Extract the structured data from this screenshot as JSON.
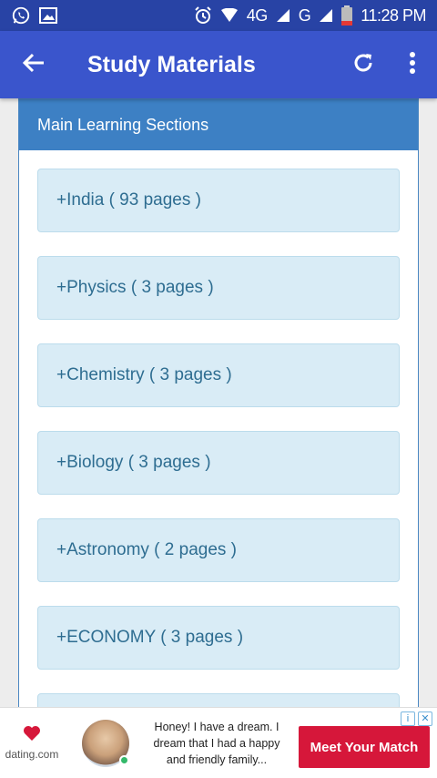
{
  "status_bar": {
    "network_4g": "4G",
    "network_g": "G",
    "time": "11:28 PM",
    "icons": [
      "whatsapp-icon",
      "image-icon",
      "alarm-icon",
      "wifi-icon",
      "signal-icon",
      "battery-icon"
    ]
  },
  "app_bar": {
    "title": "Study Materials",
    "icons": [
      "back-arrow-icon",
      "refresh-icon",
      "more-vert-icon"
    ]
  },
  "panel": {
    "header": "Main Learning Sections",
    "sections": [
      {
        "label": "+India ( 93 pages )"
      },
      {
        "label": "+Physics ( 3 pages )"
      },
      {
        "label": "+Chemistry ( 3 pages )"
      },
      {
        "label": "+Biology ( 3 pages )"
      },
      {
        "label": "+Astronomy ( 2 pages )"
      },
      {
        "label": "+ECONOMY ( 3 pages )"
      },
      {
        "label": ""
      }
    ]
  },
  "ad": {
    "brand": "dating.com",
    "text": "Honey! I have a dream. I dream that I had a happy and friendly family...",
    "cta": "Meet Your Match",
    "choices_icon": "i",
    "close_icon": "✕"
  },
  "colors": {
    "status_bar": "#2843a5",
    "app_bar": "#3a55cc",
    "panel_header": "#3d80c4",
    "section_bg": "#d9ecf6",
    "section_text": "#2e6d91",
    "ad_cta": "#d6173a"
  }
}
